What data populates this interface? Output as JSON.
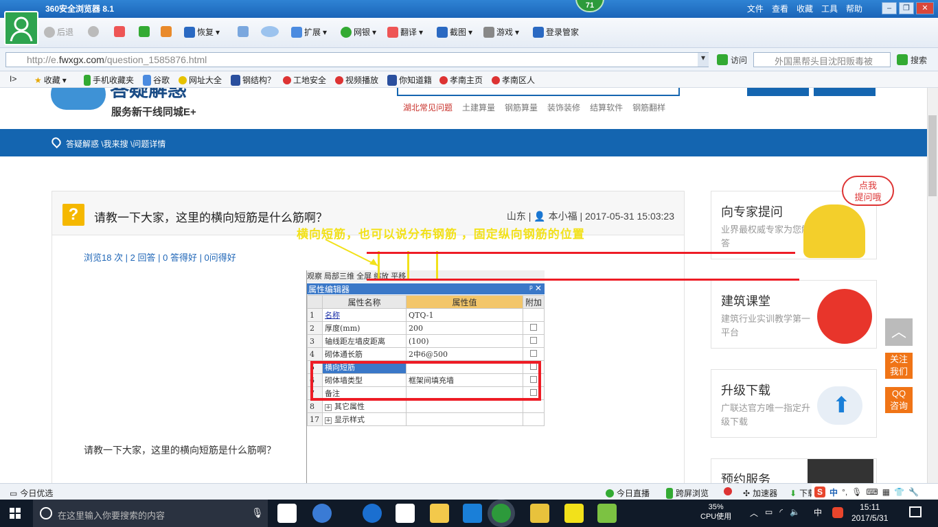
{
  "browser": {
    "title": "360安全浏览器 8.1",
    "badge": "71",
    "menu": [
      "文件",
      "查看",
      "收藏",
      "工具",
      "帮助"
    ],
    "toolbar": {
      "back": "后退",
      "restore": "恢复",
      "extensions": "扩展",
      "netbank": "网银",
      "translate": "翻译",
      "screenshot": "截图",
      "games": "游戏",
      "login_manager": "登录管家"
    },
    "url": {
      "prefix": "http://e.",
      "domain": "fwxgx.com",
      "path": "/question_1585876.html"
    },
    "visit_label": "访问",
    "search_placeholder": "外国黑帮头目沈阳贩毒被",
    "search_button": "搜索",
    "favorites": [
      "收藏",
      "手机收藏夹",
      "谷歌",
      "网址大全",
      "钢结构？",
      "工地安全",
      "视频播放",
      "你知道籍",
      "孝南主页",
      "孝南区人"
    ]
  },
  "site": {
    "logo_text": "答疑解惑",
    "slogan": "服务新干线同城E+",
    "nav": [
      "湖北常见问题",
      "土建算量",
      "钢筋算量",
      "装饰装修",
      "结算软件",
      "钢筋翻样"
    ],
    "breadcrumb": "答疑解惑 \\我来搜 \\问题详情"
  },
  "question": {
    "title": "请教一下大家，这里的横向短筋是什么筋啊？",
    "meta": "山东 | 👤 本小福 | 2017-05-31 15:03:23",
    "stats": "浏览18 次 | 2 回答 | 0 答得好 | 0问得好",
    "body": "请教一下大家，这里的横向短筋是什么筋啊？",
    "annotation": "横向短筋，也可以说分布钢筋 ，固定纵向钢筋的位置"
  },
  "property_editor": {
    "strip_text": "观察  局部三维  全屏  缩放  平移",
    "title": "属性编辑器",
    "headers": [
      "属性名称",
      "属性值",
      "附加"
    ],
    "rows": [
      {
        "num": "1",
        "name": "名称",
        "value": "QTQ-1",
        "check": false,
        "link": true
      },
      {
        "num": "2",
        "name": "厚度(mm)",
        "value": "200",
        "check": true
      },
      {
        "num": "3",
        "name": "轴线距左墙皮距离",
        "value": "(100)",
        "check": true
      },
      {
        "num": "4",
        "name": "砌体通长筋",
        "value": "2中6@500",
        "check": true
      },
      {
        "num": "5",
        "name": "横向短筋",
        "value": "",
        "check": true,
        "selected": true
      },
      {
        "num": "6",
        "name": "砌体墙类型",
        "value": "框架间填充墙",
        "check": true
      },
      {
        "num": "7",
        "name": "备注",
        "value": "",
        "check": true
      },
      {
        "num": "8",
        "name": "其它属性",
        "value": "",
        "check": false,
        "expand": true
      },
      {
        "num": "17",
        "name": "显示样式",
        "value": "",
        "check": false,
        "expand": true
      }
    ]
  },
  "sidebar": {
    "bubble": "点我\n提问哦",
    "cards": [
      {
        "title": "向专家提问",
        "sub": "业界最权威专家为您解答"
      },
      {
        "title": "建筑课堂",
        "sub": "建筑行业实训教学第一平台"
      },
      {
        "title": "升级下载",
        "sub": "广联达官方唯一指定升级下载"
      },
      {
        "title": "预约服务",
        "sub": ""
      }
    ],
    "float_follow": "关注\n我们",
    "float_qq": "QQ\n咨询"
  },
  "statusbar": {
    "today_pick": "今日优选",
    "today_live": "今日直播",
    "cross_screen": "跨屏浏览",
    "accelerator": "加速器",
    "download": "下载"
  },
  "taskbar": {
    "search_placeholder": "在这里输入你要搜索的内容",
    "cpu_percent": "35%",
    "cpu_label": "CPU使用",
    "ime": "中",
    "time": "15:11",
    "date": "2017/5/31"
  },
  "colors": {
    "brand_blue": "#1465b0",
    "accent_red": "#ee1c25",
    "annotation_yellow": "#f2e11a",
    "float_orange": "#f07416"
  }
}
